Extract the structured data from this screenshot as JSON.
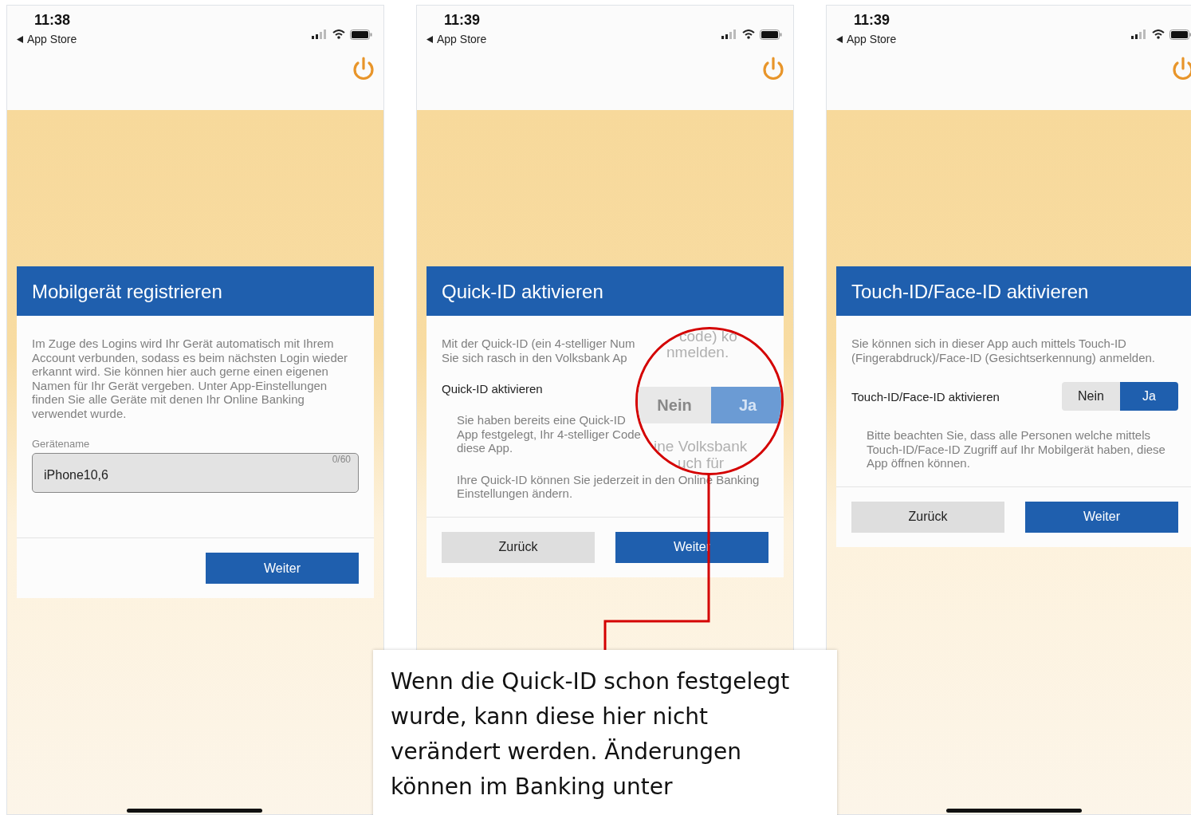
{
  "screens": [
    {
      "status": {
        "time": "11:38",
        "back": "App Store"
      },
      "card": {
        "title": "Mobilgerät registrieren",
        "paragraphs": [
          {
            "kind": "intro",
            "lines": [
              "Im Zuge des Logins wird Ihr Gerät automatisch mit Ihrem Account verbunden, sodass es beim nächsten Login wieder erkannt wird. Sie können hier auch gerne einen eigenen Namen für Ihr Gerät vergeben. Unter App-Einstellungen finden Sie alle Geräte mit denen Ihr Online Banking verwendet wurde."
            ]
          }
        ],
        "field": {
          "label": "Gerätename",
          "value": "iPhone10,6",
          "counter": "0/60"
        },
        "buttons": [
          {
            "label": "Weiter",
            "kind": "primary"
          }
        ]
      }
    },
    {
      "status": {
        "time": "11:39",
        "back": "App Store"
      },
      "card": {
        "title": "Quick-ID aktivieren",
        "paragraphs": [
          {
            "kind": "intro",
            "lines": [
              "Mit der Quick-ID (ein 4-stelliger Num",
              "Sie sich rasch in den Volksbank Ap"
            ]
          },
          {
            "kind": "toggle",
            "label": "Quick-ID aktivieren"
          },
          {
            "kind": "note",
            "lines": [
              "Sie haben bereits eine Quick-ID",
              "App festgelegt, Ihr 4-stelliger Code",
              "diese App."
            ]
          },
          {
            "kind": "note",
            "lines": [
              "Ihre Quick-ID können Sie jederzeit in den Online Banking Einstellungen ändern."
            ]
          }
        ],
        "buttons": [
          {
            "label": "Zurück",
            "kind": "secondary"
          },
          {
            "label": "Weiter",
            "kind": "primary"
          }
        ]
      }
    },
    {
      "status": {
        "time": "11:39",
        "back": "App Store"
      },
      "card": {
        "title": "Touch-ID/Face-ID aktivieren",
        "paragraphs": [
          {
            "kind": "intro",
            "lines": [
              "Sie können sich in dieser App auch mittels Touch-ID (Fingerabdruck)/Face-ID (Gesichtserkennung) anmelden."
            ]
          },
          {
            "kind": "toggle",
            "label": "Touch-ID/Face-ID aktivieren",
            "options": [
              {
                "label": "Nein",
                "selected": false
              },
              {
                "label": "Ja",
                "selected": true
              }
            ]
          },
          {
            "kind": "note",
            "lines": [
              "Bitte beachten Sie, dass alle Personen welche mittels Touch-ID/Face-ID Zugriff auf Ihr Mobilgerät haben, diese App öffnen können."
            ]
          }
        ],
        "buttons": [
          {
            "label": "Zurück",
            "kind": "secondary"
          },
          {
            "label": "Weiter",
            "kind": "primary"
          }
        ]
      }
    }
  ],
  "magnifier": {
    "top_lines": [
      "code) ko",
      "nmelden."
    ],
    "toggle": {
      "options": [
        {
          "label": "Nein",
          "selected": false
        },
        {
          "label": "Ja",
          "selected": true
        }
      ],
      "disabled": true
    },
    "bottom_lines": [
      "ine Volksbank",
      "uch für"
    ]
  },
  "callout": {
    "lines": [
      "Wenn die Quick-ID schon festgelegt",
      "wurde, kann diese hier nicht",
      "verändert werden. Änderungen",
      "können im Banking unter"
    ]
  }
}
